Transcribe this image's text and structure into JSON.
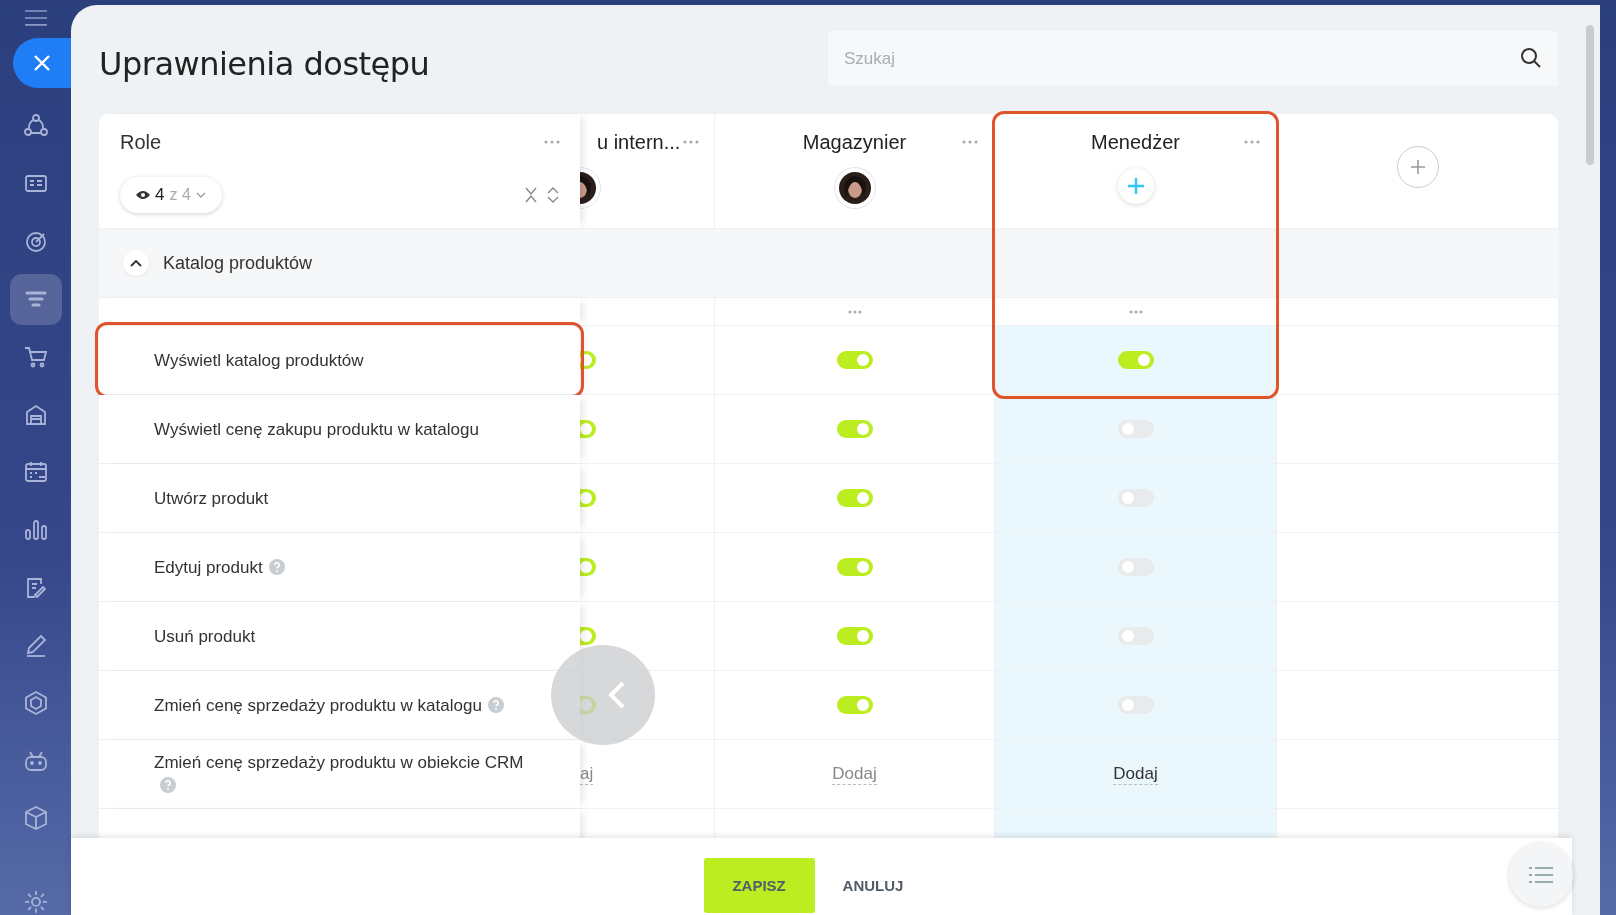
{
  "sidebar": {
    "items": [
      {
        "selected": false
      },
      {
        "selected": false
      },
      {
        "selected": false
      },
      {
        "selected": true
      },
      {
        "selected": false
      },
      {
        "selected": false
      },
      {
        "selected": false
      },
      {
        "selected": false
      },
      {
        "selected": false
      },
      {
        "selected": false
      },
      {
        "selected": false
      },
      {
        "selected": false
      },
      {
        "selected": false
      }
    ]
  },
  "title": "Uprawnienia dostępu",
  "search": {
    "placeholder": "Szukaj"
  },
  "roles_header": {
    "label": "Role",
    "shown": "4",
    "total": "z 4"
  },
  "columns": [
    {
      "title": "u intern...",
      "kind": "photo",
      "highlighted": false,
      "outlined": false
    },
    {
      "title": "Magazynier",
      "kind": "photo",
      "highlighted": false,
      "outlined": false
    },
    {
      "title": "Menedżer",
      "kind": "add",
      "highlighted": true,
      "outlined": true
    }
  ],
  "section": {
    "label": "Katalog produktów",
    "expanded": true
  },
  "rows": [
    {
      "label": "Wyświetl katalog produktów",
      "help": false,
      "outlined": true,
      "kind": "toggle",
      "cells": [
        {
          "on": true
        },
        {
          "on": true
        },
        {
          "on": true
        }
      ]
    },
    {
      "label": "Wyświetl cenę zakupu produktu w katalogu",
      "help": false,
      "outlined": false,
      "kind": "toggle",
      "cells": [
        {
          "on": true
        },
        {
          "on": true
        },
        {
          "on": false
        }
      ]
    },
    {
      "label": "Utwórz produkt",
      "help": false,
      "outlined": false,
      "kind": "toggle",
      "cells": [
        {
          "on": true
        },
        {
          "on": true
        },
        {
          "on": false
        }
      ]
    },
    {
      "label": "Edytuj produkt",
      "help": true,
      "outlined": false,
      "kind": "toggle",
      "cells": [
        {
          "on": true
        },
        {
          "on": true
        },
        {
          "on": false
        }
      ]
    },
    {
      "label": "Usuń produkt",
      "help": false,
      "outlined": false,
      "kind": "toggle",
      "cells": [
        {
          "on": true
        },
        {
          "on": true
        },
        {
          "on": false
        }
      ]
    },
    {
      "label": "Zmień cenę sprzedaży produktu w katalogu",
      "help": true,
      "outlined": false,
      "kind": "toggle",
      "cells": [
        {
          "on": true
        },
        {
          "on": true
        },
        {
          "on": false
        }
      ]
    },
    {
      "label": "Zmień cenę sprzedaży produktu w obiekcie CRM",
      "help": true,
      "outlined": false,
      "kind": "link",
      "cells": [
        {
          "text": "aj"
        },
        {
          "text": "Dodaj"
        },
        {
          "text": "Dodaj"
        }
      ]
    }
  ],
  "footer": {
    "save": "ZAPISZ",
    "cancel": "ANULUJ"
  }
}
